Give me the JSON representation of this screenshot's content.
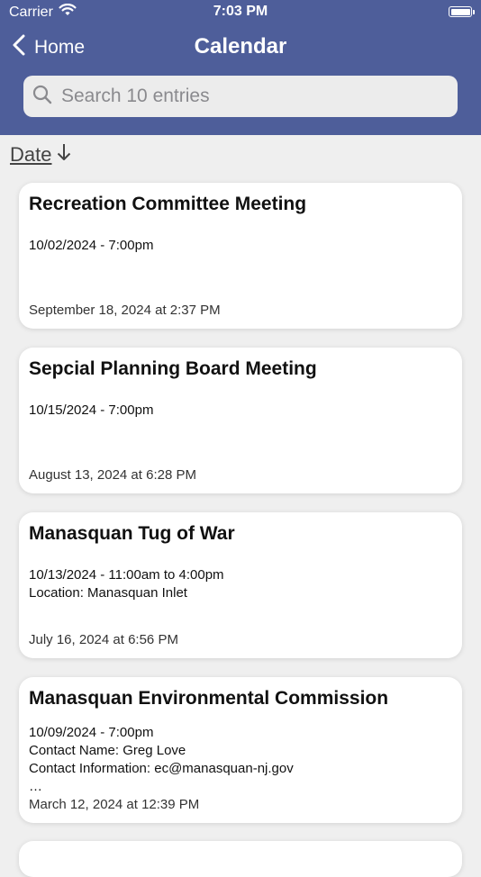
{
  "status_bar": {
    "carrier": "Carrier",
    "time": "7:03 PM",
    "wifi_icon": "wifi-icon",
    "battery_icon": "battery-icon"
  },
  "nav": {
    "back_label": "Home",
    "title": "Calendar",
    "back_icon": "chevron-left-icon"
  },
  "search": {
    "placeholder": "Search 10 entries",
    "value": "",
    "icon": "search-icon"
  },
  "sort": {
    "label": "Date",
    "icon": "arrow-down-icon"
  },
  "entries": [
    {
      "title": "Recreation Committee Meeting",
      "details": "10/02/2024 - 7:00pm",
      "updated": "September 18, 2024 at 2:37 PM"
    },
    {
      "title": "Sepcial Planning Board Meeting",
      "details": "10/15/2024 - 7:00pm",
      "updated": "August 13, 2024 at 6:28 PM"
    },
    {
      "title": "Manasquan Tug of War",
      "details": "10/13/2024 - 11:00am to 4:00pm\nLocation: Manasquan Inlet",
      "updated": "July 16, 2024 at 6:56 PM"
    },
    {
      "title": "Manasquan Environmental Commission",
      "details": "10/09/2024 - 7:00pm\nContact Name: Greg Love\nContact Information: ec@manasquan-nj.gov\n…",
      "updated": "March 12, 2024 at 12:39 PM"
    }
  ],
  "colors": {
    "header": "#4e5e9a",
    "background": "#efefef",
    "card": "#ffffff"
  }
}
